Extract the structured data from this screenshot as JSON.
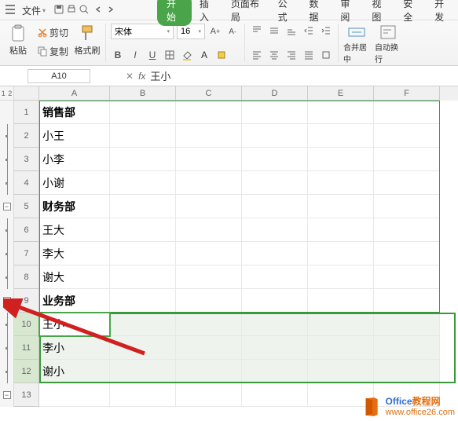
{
  "menu": {
    "file": "文件",
    "tabs": [
      "开始",
      "插入",
      "页面布局",
      "公式",
      "数据",
      "审阅",
      "视图",
      "安全",
      "开发"
    ]
  },
  "ribbon": {
    "cut": "剪切",
    "copy": "复制",
    "fmtpaint": "格式刷",
    "paste": "粘贴",
    "font_name": "宋体",
    "font_size": "16",
    "merge_center": "合并居中",
    "auto_wrap": "自动换行"
  },
  "namebox": "A10",
  "fx_value": "王小",
  "columns": [
    "A",
    "B",
    "C",
    "D",
    "E",
    "F"
  ],
  "rows": [
    {
      "n": 1,
      "a": "销售部",
      "bold": true
    },
    {
      "n": 2,
      "a": "小王"
    },
    {
      "n": 3,
      "a": "小李"
    },
    {
      "n": 4,
      "a": "小谢"
    },
    {
      "n": 5,
      "a": "财务部",
      "bold": true
    },
    {
      "n": 6,
      "a": "王大"
    },
    {
      "n": 7,
      "a": "李大"
    },
    {
      "n": 8,
      "a": "谢大"
    },
    {
      "n": 9,
      "a": "业务部",
      "bold": true
    },
    {
      "n": 10,
      "a": "王小",
      "active": true,
      "selrow": true
    },
    {
      "n": 11,
      "a": "李小",
      "selrow": true
    },
    {
      "n": 12,
      "a": "谢小",
      "selrow": true
    },
    {
      "n": 13,
      "a": ""
    }
  ],
  "outline": {
    "levels": [
      "1",
      "2"
    ],
    "groups": [
      {
        "start": 2,
        "end": 4,
        "collapseAt": 5
      },
      {
        "start": 6,
        "end": 8,
        "collapseAt": 9
      },
      {
        "start": 10,
        "end": 12,
        "collapseAt": 13
      }
    ]
  },
  "watermark": {
    "brand1": "Office",
    "brand2": "教程网",
    "url": "www.office26.com"
  }
}
